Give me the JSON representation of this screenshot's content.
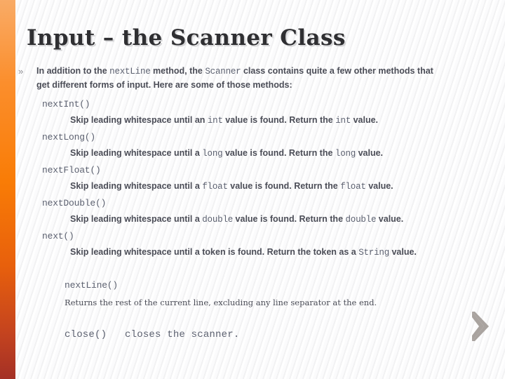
{
  "slide": {
    "title": "Input – the Scanner Class",
    "bullet_marker": "»",
    "lead": {
      "part1": "In addition to the ",
      "code1": "nextLine",
      "part2": " method, the ",
      "code2": "Scanner",
      "part3": " class contains quite a few other methods that get different forms of input. Here are some of those methods:"
    },
    "methods": [
      {
        "name": "nextInt()",
        "desc_pre": "Skip leading whitespace until an ",
        "desc_code1": "int",
        "desc_mid": " value is found. Return the ",
        "desc_code2": "int",
        "desc_post": " value."
      },
      {
        "name": "nextLong()",
        "desc_pre": "Skip leading whitespace until a ",
        "desc_code1": "long",
        "desc_mid": " value is found. Return the ",
        "desc_code2": "long",
        "desc_post": " value."
      },
      {
        "name": "nextFloat()",
        "desc_pre": "Skip leading whitespace until a ",
        "desc_code1": "float",
        "desc_mid": " value is found. Return the ",
        "desc_code2": "float",
        "desc_post": " value."
      },
      {
        "name": "nextDouble()",
        "desc_pre": "Skip leading whitespace until a ",
        "desc_code1": "double",
        "desc_mid": " value is found. Return the ",
        "desc_code2": "double",
        "desc_post": " value."
      },
      {
        "name": "next()",
        "desc_pre": "Skip leading whitespace until a token is found. Return the token as a ",
        "desc_code1": "String",
        "desc_mid": "",
        "desc_code2": "",
        "desc_post": " value."
      }
    ],
    "tail": {
      "method": "nextLine()",
      "desc": "Returns the rest of the current line, excluding any line separator at the end."
    },
    "close": {
      "text": "close()   closes the scanner."
    },
    "nav": {
      "next_icon": "chevron-right-icon"
    },
    "colors": {
      "accent_top": "#f9ab66",
      "accent_mid": "#f97c06",
      "accent_bottom": "#a43025",
      "title_text": "#2f2f32",
      "body_text": "#4b4d57",
      "code_text": "#5c6170",
      "chevron": "#a9a39f"
    }
  }
}
